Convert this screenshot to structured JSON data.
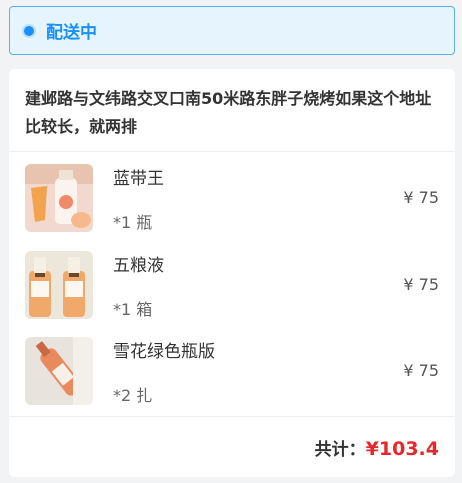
{
  "status": {
    "label": "配送中",
    "accent": "#1890ff",
    "icon": "status-dot-icon"
  },
  "address": "建邺路与文纬路交叉口南50米路东胖子烧烤如果这个地址比较长，就两排",
  "items": [
    {
      "name": "蓝带王",
      "qty": "*1 瓶",
      "price": "¥ 75"
    },
    {
      "name": "五粮液",
      "qty": "*1 箱",
      "price": "¥ 75"
    },
    {
      "name": "雪花绿色瓶版",
      "qty": "*2 扎",
      "price": "¥ 75"
    }
  ],
  "total": {
    "label": "共计：",
    "amount": "¥103.4",
    "amount_color": "#e8272d"
  }
}
